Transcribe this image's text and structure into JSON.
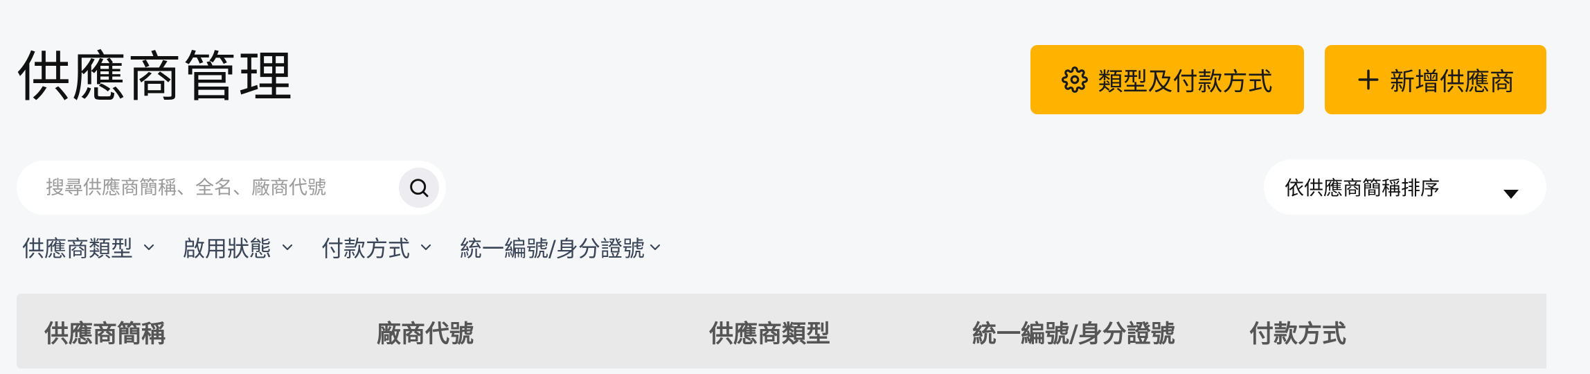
{
  "page": {
    "title": "供應商管理"
  },
  "actions": {
    "types_payment_label": "類型及付款方式",
    "add_supplier_label": "新增供應商"
  },
  "search": {
    "placeholder": "搜尋供應商簡稱、全名、廠商代號",
    "value": ""
  },
  "sort": {
    "selected": "依供應商簡稱排序"
  },
  "filters": [
    {
      "label": "供應商類型"
    },
    {
      "label": "啟用狀態"
    },
    {
      "label": "付款方式"
    },
    {
      "label": "統一編號/身分證號"
    }
  ],
  "table": {
    "columns": [
      "供應商簡稱",
      "廠商代號",
      "供應商類型",
      "統一編號/身分證號",
      "付款方式"
    ]
  },
  "colors": {
    "accent": "#ffb300",
    "background": "#f6f7f9",
    "header_bg": "#e9e9e9"
  },
  "icons": {
    "types_button": "gear-icon",
    "add_button": "plus-icon",
    "search": "search-icon",
    "sort": "caret-down-icon",
    "filter": "chevron-down-icon"
  }
}
